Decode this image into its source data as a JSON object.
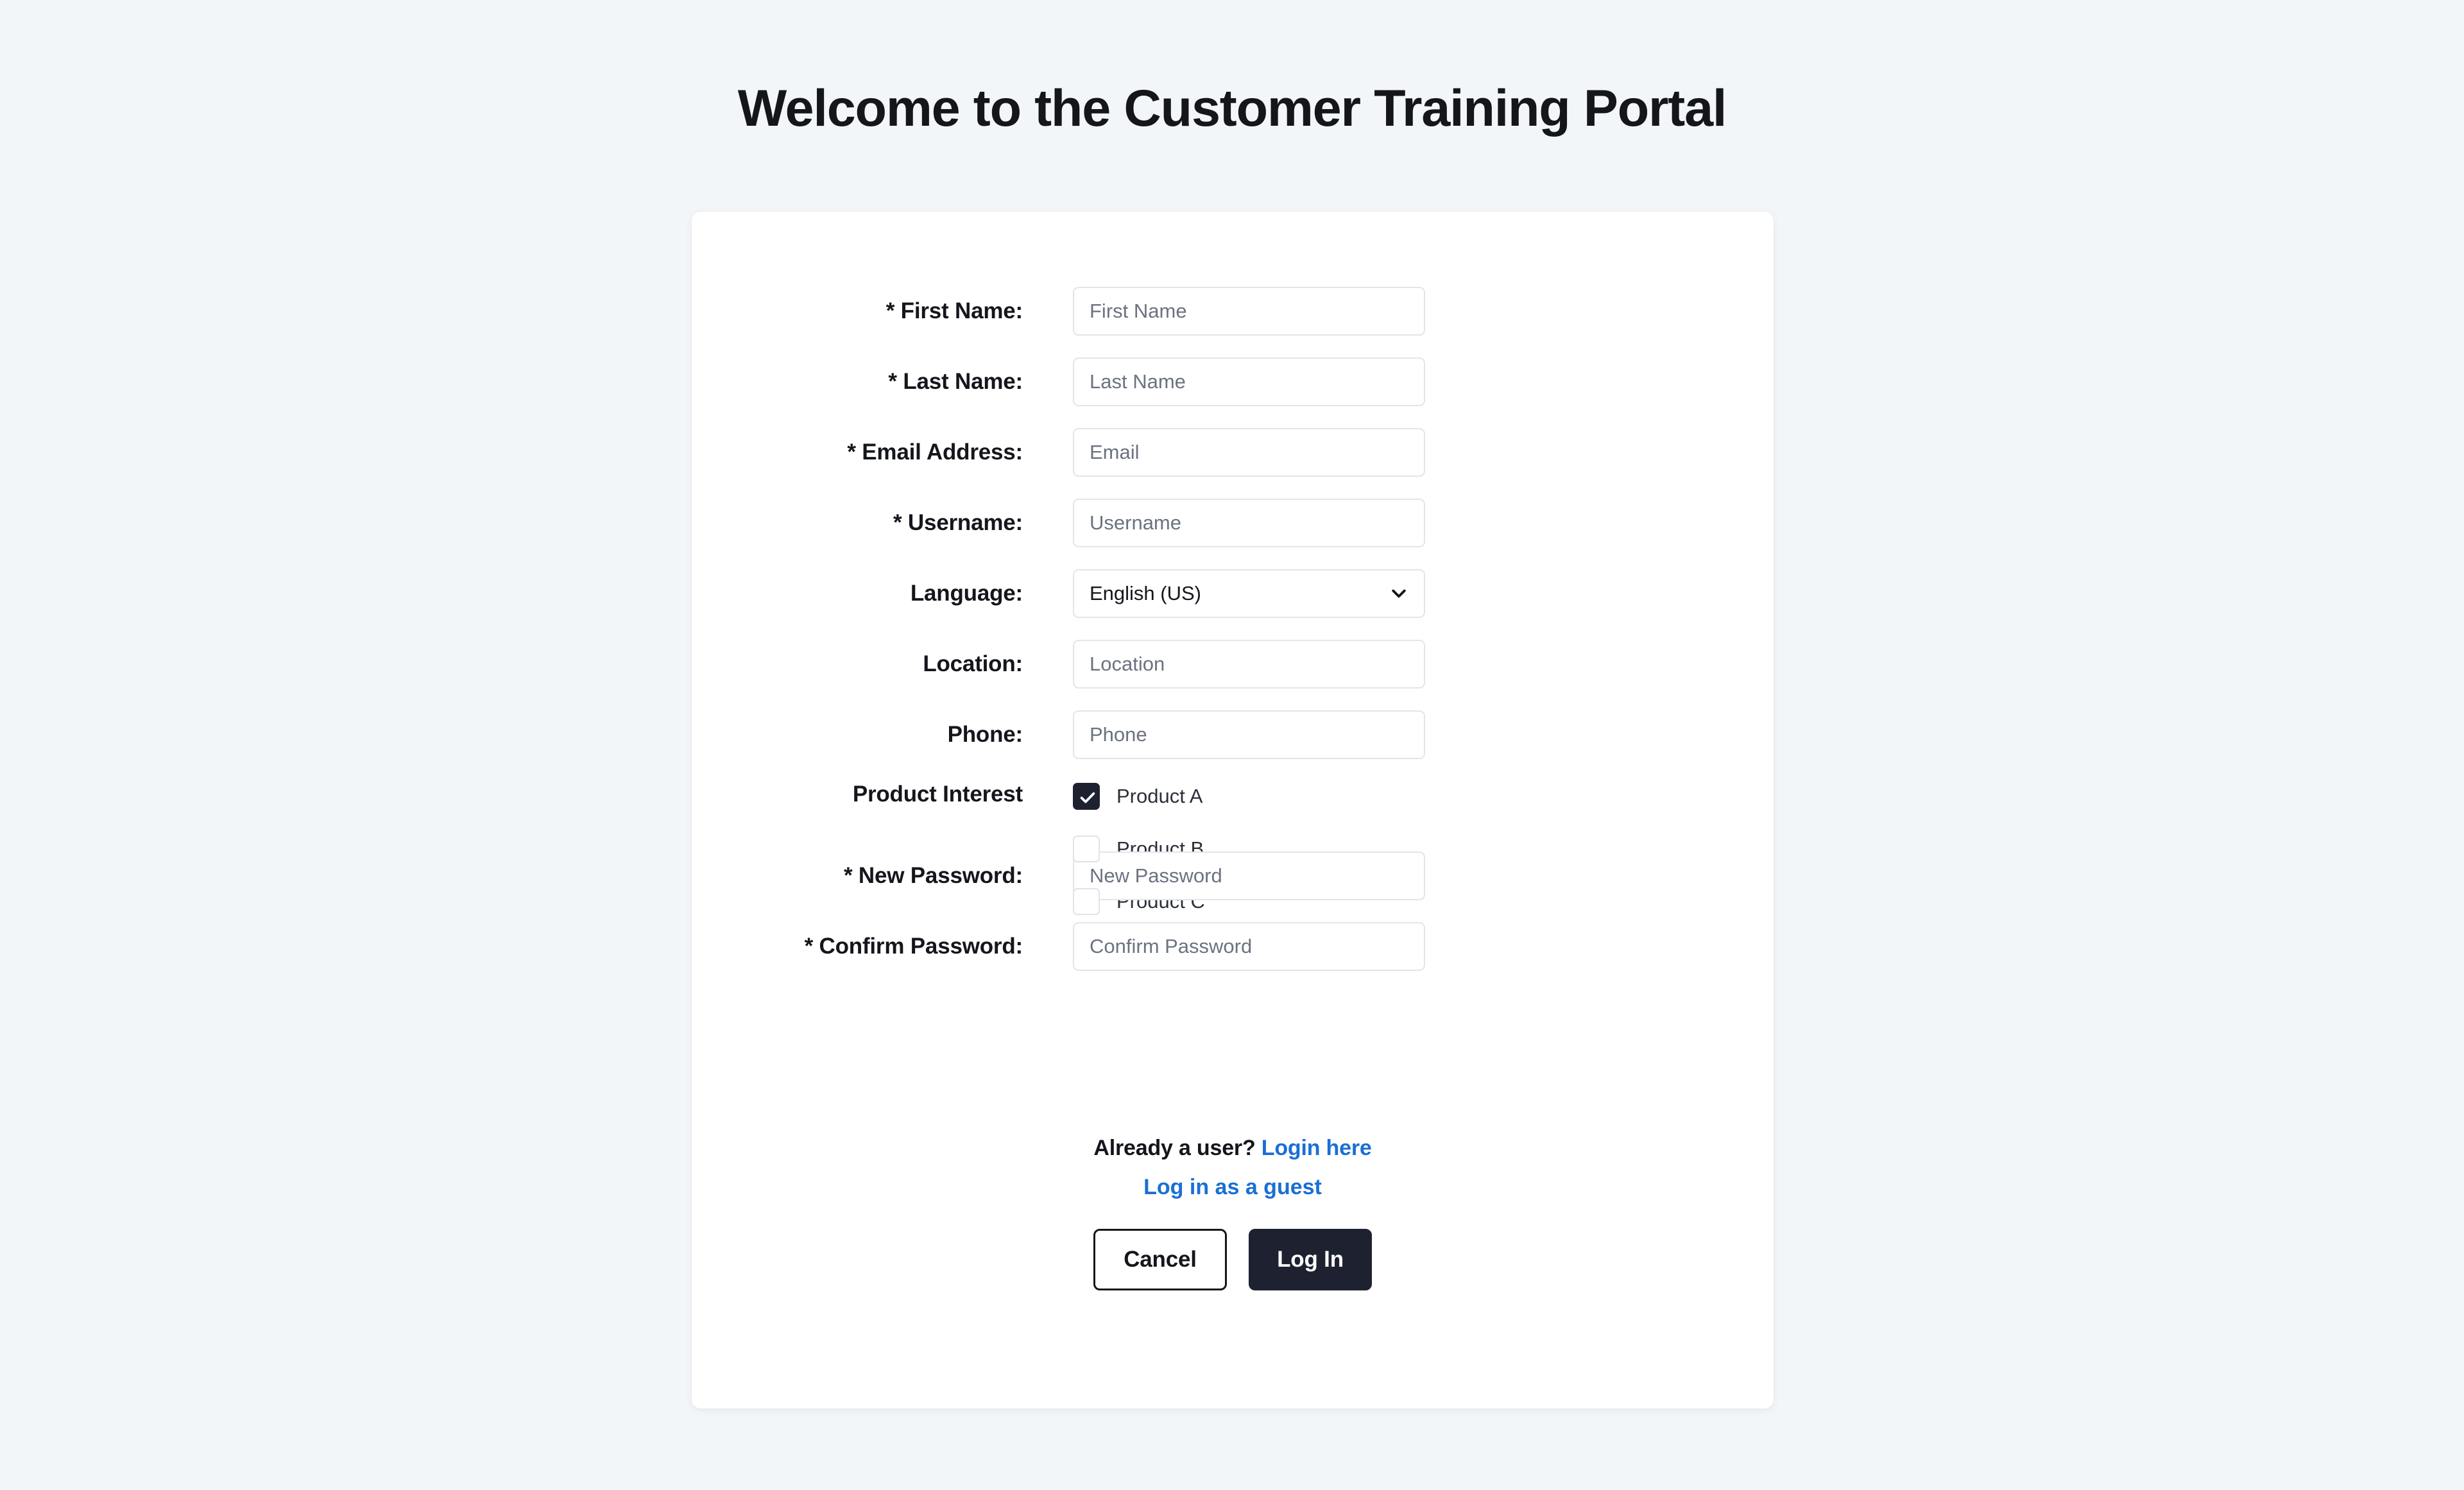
{
  "page": {
    "title": "Welcome to the Customer Training Portal",
    "background_color": "#f3f6f8",
    "card_background": "#ffffff",
    "accent_link_color": "#1a6fd4",
    "primary_button_color": "#1e2230"
  },
  "form": {
    "fields": [
      {
        "label": "* First Name:",
        "placeholder": "First Name",
        "value": "",
        "type": "text"
      },
      {
        "label": "* Last Name:",
        "placeholder": "Last Name",
        "value": "",
        "type": "text"
      },
      {
        "label": "* Email Address:",
        "placeholder": "Email",
        "value": "",
        "type": "text"
      },
      {
        "label": "* Username:",
        "placeholder": "Username",
        "value": "",
        "type": "text"
      },
      {
        "label": "Location:",
        "placeholder": "Location",
        "value": "",
        "type": "text"
      },
      {
        "label": "Phone:",
        "placeholder": "Phone",
        "value": "",
        "type": "text"
      },
      {
        "label": "* New Password:",
        "placeholder": "New Password",
        "value": "",
        "type": "password"
      },
      {
        "label": "* Confirm Password:",
        "placeholder": "Confirm Password",
        "value": "",
        "type": "password"
      }
    ],
    "language": {
      "label": "Language:",
      "selected": "English (US)",
      "icon": "chevron-down-icon"
    },
    "product_interest": {
      "label": "Product Interest",
      "options": [
        {
          "label": "Product A",
          "checked": true
        },
        {
          "label": "Product B",
          "checked": false
        },
        {
          "label": "Product C",
          "checked": false
        }
      ]
    }
  },
  "footer": {
    "already_user_text": "Already a user?",
    "login_here_label": "Login here",
    "guest_login_label": "Log in as a guest",
    "cancel_label": "Cancel",
    "login_label": "Log In"
  }
}
